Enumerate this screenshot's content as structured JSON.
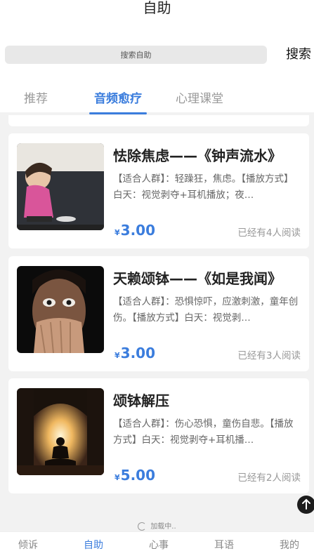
{
  "page": {
    "title": "自助"
  },
  "search": {
    "placeholder": "搜索自助",
    "button_label": "搜索"
  },
  "tabs": [
    {
      "label": "推荐",
      "active": false
    },
    {
      "label": "音频愈疗",
      "active": true
    },
    {
      "label": "心理课堂",
      "active": false
    }
  ],
  "cards": [
    {
      "title": "怯除焦虑——《钟声流水》",
      "description": "【适合人群】：轻躁狂，焦虑。【播放方式】白天：视觉剥夺+耳机播放；夜…",
      "currency": "¥",
      "price": "3.00",
      "reads": "已经有4人阅读",
      "thumb_icon": "child-photo"
    },
    {
      "title": "天赖颂钵——《如是我闻》",
      "description": "【适合人群】：恐惧惊吓，应激刺激，童年创伤。【播放方式】白天：视觉剥…",
      "currency": "¥",
      "price": "3.00",
      "reads": "已经有3人阅读",
      "thumb_icon": "frightened-face-photo"
    },
    {
      "title": "颂钵解压",
      "description": "【适合人群】：伤心恐惧，童伤自悲。【播放方式】白天：视觉剥夺+耳机播…",
      "currency": "¥",
      "price": "5.00",
      "reads": "已经有2人阅读",
      "thumb_icon": "meditation-silhouette-photo"
    }
  ],
  "loading_text": "加载中..",
  "bottom_nav": [
    {
      "label": "倾诉",
      "active": false
    },
    {
      "label": "自助",
      "active": true
    },
    {
      "label": "心事",
      "active": false
    },
    {
      "label": "耳语",
      "active": false
    },
    {
      "label": "我的",
      "active": false
    }
  ],
  "colors": {
    "accent": "#3b7ddd",
    "background": "#f2f2f2"
  }
}
